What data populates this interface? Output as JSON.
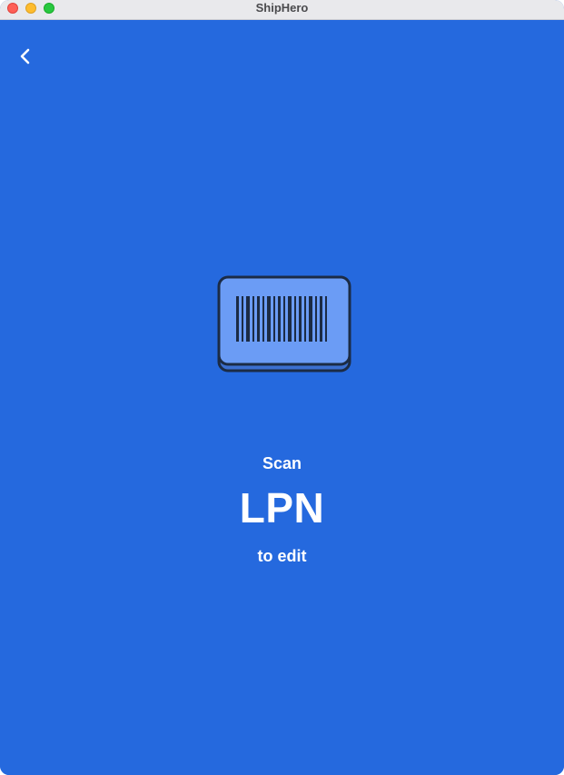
{
  "window": {
    "title": "ShipHero"
  },
  "icons": {
    "back": "chevron-left-icon",
    "illustration": "barcode-card-icon"
  },
  "colors": {
    "background": "#2569de",
    "card": "#6b9cf5",
    "ink": "#1b2b45",
    "text": "#ffffff"
  },
  "scan_prompt": {
    "line1": "Scan",
    "target": "LPN",
    "line3": "to edit"
  }
}
